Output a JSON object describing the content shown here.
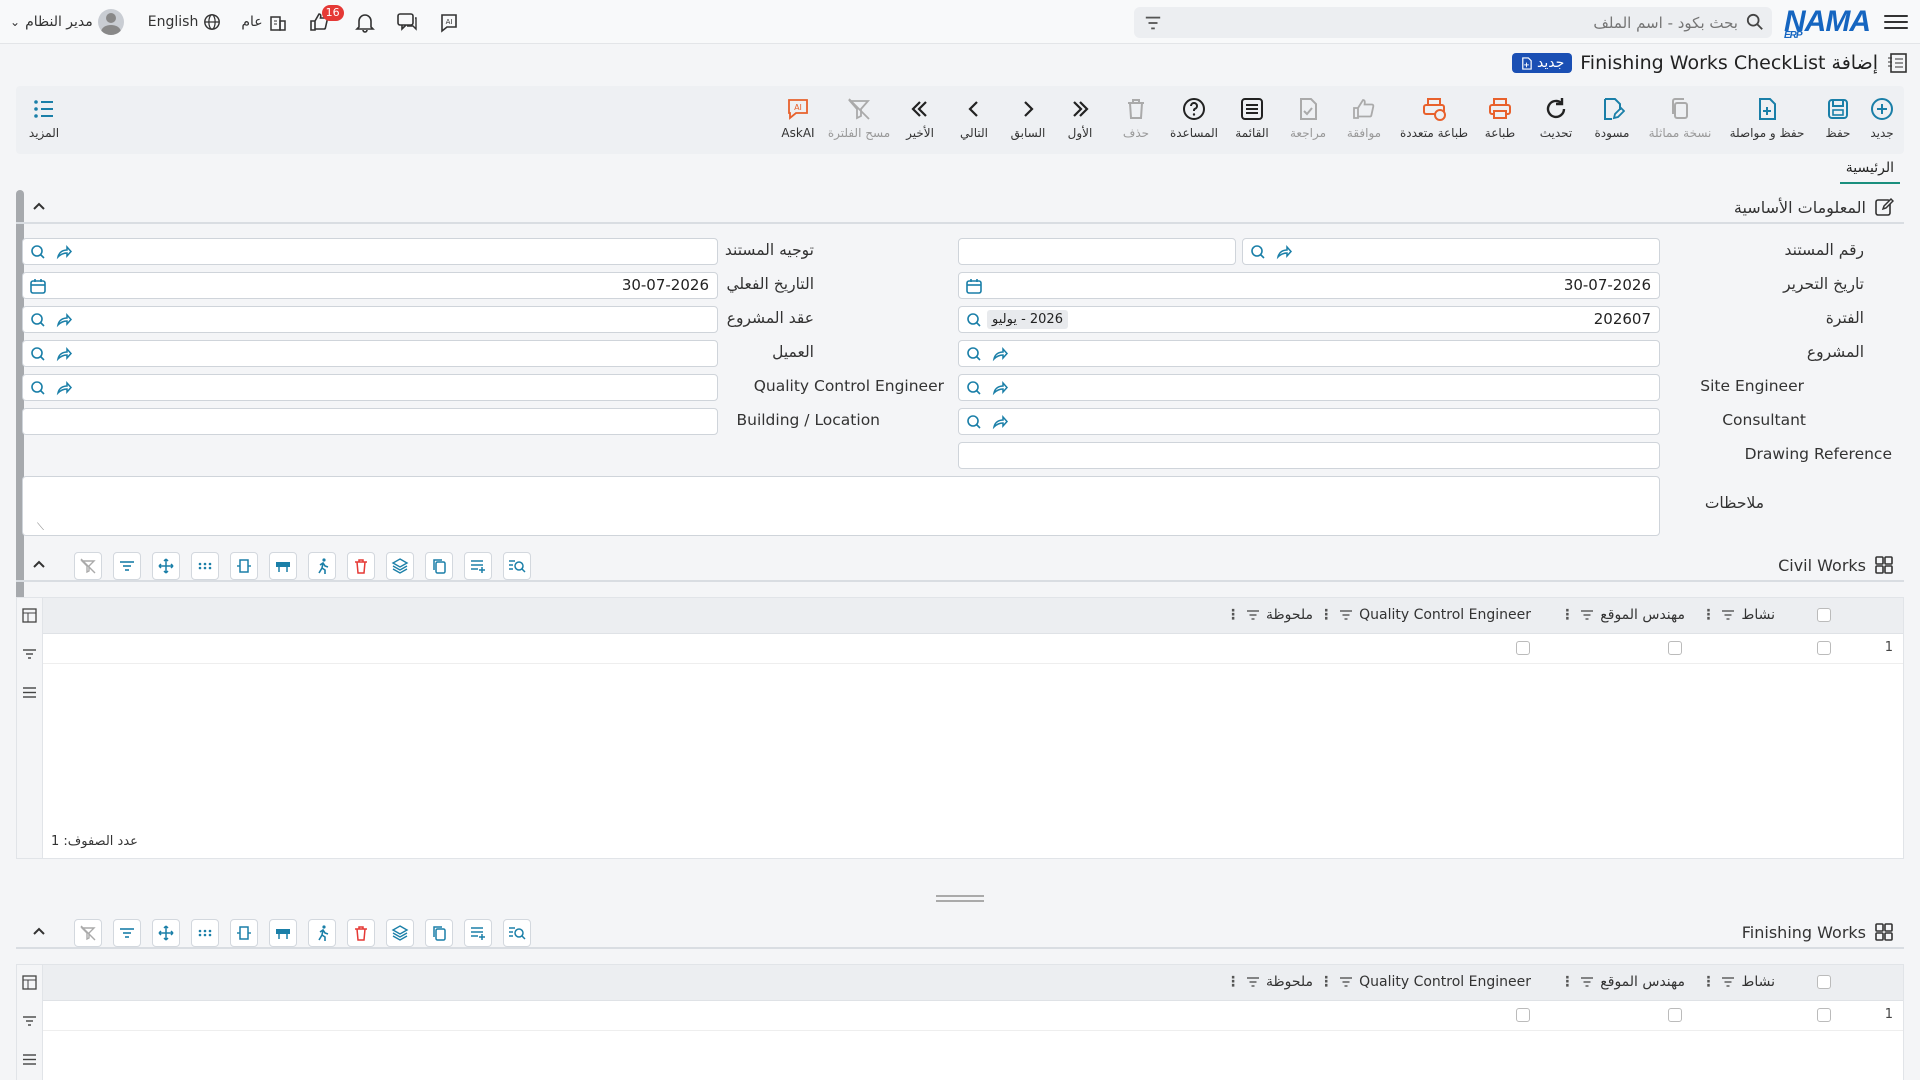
{
  "app": {
    "logo": "NAMA",
    "logo_sub": "ERP",
    "search_placeholder": "بحث بكود - اسم الملف",
    "user_name": "مدير النظام",
    "language": "English",
    "company": "عام",
    "notification_count": "16"
  },
  "page": {
    "title": "إضافة Finishing Works CheckList",
    "badge": "جديد"
  },
  "toolbar": {
    "new": "جديد",
    "save": "حفظ",
    "save_continue": "حفظ و مواصلة",
    "duplicate": "نسخة مماثلة",
    "draft": "مسودة",
    "refresh": "تحديث",
    "print": "طباعة",
    "multi_print": "طباعة متعددة",
    "approve": "موافقة",
    "review": "مراجعة",
    "list": "القائمة",
    "help": "المساعدة",
    "delete": "حذف",
    "first": "الأول",
    "prev": "السابق",
    "next": "التالي",
    "last": "الأخير",
    "clear_filter": "مسح الفلترة",
    "ask_ai": "AskAI",
    "more": "المزيد"
  },
  "tabs": {
    "main": "الرئيسية"
  },
  "basic_info": {
    "title": "المعلومات الأساسية",
    "labels": {
      "doc_number": "رقم المستند",
      "doc_direction": "توجيه المستند",
      "edit_date": "تاريخ التحرير",
      "actual_date": "التاريخ الفعلي",
      "period": "الفترة",
      "project_contract": "عقد المشروع",
      "project": "المشروع",
      "customer": "العميل",
      "site_engineer": "Site Engineer",
      "qc_engineer": "Quality Control Engineer",
      "consultant": "Consultant",
      "building": "Building / Location",
      "drawing_ref": "Drawing Reference",
      "notes": "ملاحظات"
    },
    "values": {
      "edit_date": "30-07-2026",
      "actual_date": "30-07-2026",
      "period_code": "202607",
      "period_name": "2026 - يوليو"
    }
  },
  "civil_works": {
    "title": "Civil Works",
    "columns": [
      "نشاط",
      "مهندس الموقع",
      "Quality Control Engineer",
      "ملحوظة"
    ],
    "rows": [
      "1"
    ],
    "row_count_label": "عدد الصفوف: 1"
  },
  "finishing_works": {
    "title": "Finishing Works",
    "columns": [
      "نشاط",
      "مهندس الموقع",
      "Quality Control Engineer",
      "ملحوظة"
    ],
    "rows": [
      "1"
    ]
  },
  "colors": {
    "accent": "#1a8f7e",
    "brand": "#1565c0",
    "badge_blue": "#1a4fb4",
    "print_orange": "#e8612c",
    "icon_teal": "#1a7fa8"
  }
}
